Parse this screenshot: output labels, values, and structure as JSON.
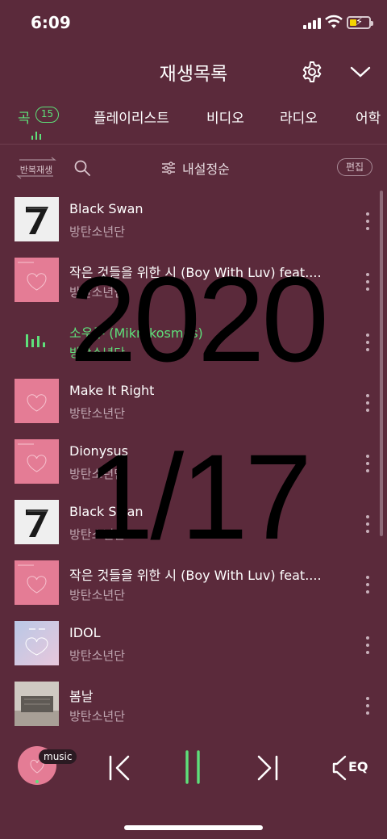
{
  "status": {
    "time": "6:09"
  },
  "header": {
    "title": "재생목록"
  },
  "tabs": [
    {
      "label": "곡",
      "badge": "15",
      "active": true
    },
    {
      "label": "플레이리스트"
    },
    {
      "label": "비디오"
    },
    {
      "label": "라디오"
    },
    {
      "label": "어학"
    }
  ],
  "toolbar": {
    "repeat_label": "반복재생",
    "sort_label": "내설정순",
    "edit_label": "편집"
  },
  "songs": [
    {
      "title": "Black Swan",
      "artist": "방탄소년단",
      "art": "album-7"
    },
    {
      "title": "작은 것들을 위한 시 (Boy With Luv) feat....",
      "artist": "방탄소년단",
      "art": "album-persona"
    },
    {
      "title": "소우주 (Mikrokosmos)",
      "artist": "방탄소년단",
      "art": "now-playing",
      "playing": true
    },
    {
      "title": "Make It Right",
      "artist": "방탄소년단",
      "art": "album-persona"
    },
    {
      "title": "Dionysus",
      "artist": "방탄소년단",
      "art": "album-persona"
    },
    {
      "title": "Black Swan",
      "artist": "방탄소년단",
      "art": "album-7"
    },
    {
      "title": "작은 것들을 위한 시 (Boy With Luv) feat....",
      "artist": "방탄소년단",
      "art": "album-persona"
    },
    {
      "title": "IDOL",
      "artist": "방탄소년단",
      "art": "album-answer"
    },
    {
      "title": "봄날",
      "artist": "방탄소년단",
      "art": "album-wings"
    }
  ],
  "overlay": {
    "year": "2020",
    "date": "1/17"
  },
  "player": {
    "mini_label": "music",
    "eq_label": "EQ"
  },
  "colors": {
    "background": "#5b2a3b",
    "accent": "#5ee07a",
    "persona_pink": "#e47c95"
  }
}
